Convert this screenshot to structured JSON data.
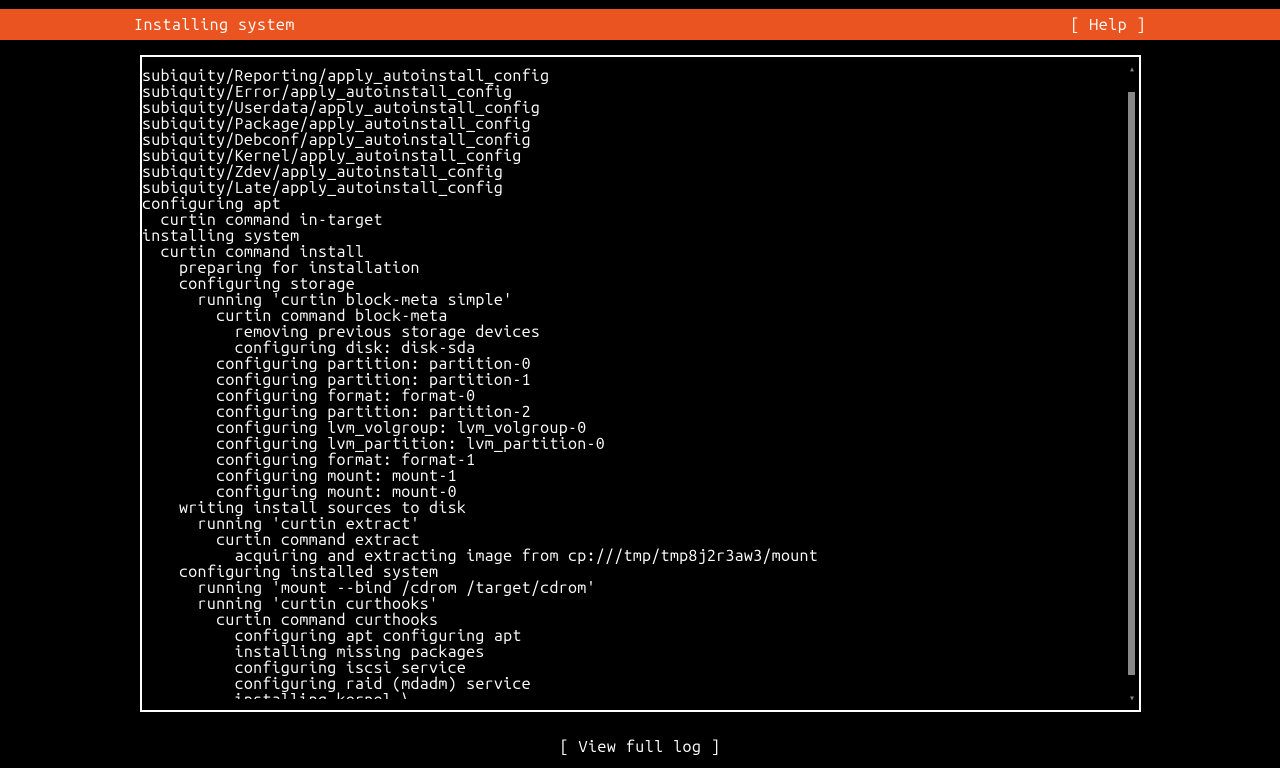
{
  "header": {
    "title": "Installing system",
    "help_label": "[ Help ]"
  },
  "footer": {
    "view_full_log": "[ View full log ]"
  },
  "log": {
    "lines": [
      {
        "indent": 0,
        "text": "subiquity/Reporting/apply_autoinstall_config"
      },
      {
        "indent": 0,
        "text": "subiquity/Error/apply_autoinstall_config"
      },
      {
        "indent": 0,
        "text": "subiquity/Userdata/apply_autoinstall_config"
      },
      {
        "indent": 0,
        "text": "subiquity/Package/apply_autoinstall_config"
      },
      {
        "indent": 0,
        "text": "subiquity/Debconf/apply_autoinstall_config"
      },
      {
        "indent": 0,
        "text": "subiquity/Kernel/apply_autoinstall_config"
      },
      {
        "indent": 0,
        "text": "subiquity/Zdev/apply_autoinstall_config"
      },
      {
        "indent": 0,
        "text": "subiquity/Late/apply_autoinstall_config"
      },
      {
        "indent": 0,
        "text": "configuring apt"
      },
      {
        "indent": 2,
        "text": "curtin command in-target"
      },
      {
        "indent": 0,
        "text": "installing system"
      },
      {
        "indent": 2,
        "text": "curtin command install"
      },
      {
        "indent": 4,
        "text": "preparing for installation"
      },
      {
        "indent": 4,
        "text": "configuring storage"
      },
      {
        "indent": 6,
        "text": "running 'curtin block-meta simple'"
      },
      {
        "indent": 8,
        "text": "curtin command block-meta"
      },
      {
        "indent": 10,
        "text": "removing previous storage devices"
      },
      {
        "indent": 10,
        "text": "configuring disk: disk-sda"
      },
      {
        "indent": 8,
        "text": "configuring partition: partition-0"
      },
      {
        "indent": 8,
        "text": "configuring partition: partition-1"
      },
      {
        "indent": 8,
        "text": "configuring format: format-0"
      },
      {
        "indent": 8,
        "text": "configuring partition: partition-2"
      },
      {
        "indent": 8,
        "text": "configuring lvm_volgroup: lvm_volgroup-0"
      },
      {
        "indent": 8,
        "text": "configuring lvm_partition: lvm_partition-0"
      },
      {
        "indent": 8,
        "text": "configuring format: format-1"
      },
      {
        "indent": 8,
        "text": "configuring mount: mount-1"
      },
      {
        "indent": 8,
        "text": "configuring mount: mount-0"
      },
      {
        "indent": 4,
        "text": "writing install sources to disk"
      },
      {
        "indent": 6,
        "text": "running 'curtin extract'"
      },
      {
        "indent": 8,
        "text": "curtin command extract"
      },
      {
        "indent": 10,
        "text": "acquiring and extracting image from cp:///tmp/tmp8j2r3aw3/mount"
      },
      {
        "indent": 4,
        "text": "configuring installed system"
      },
      {
        "indent": 6,
        "text": "running 'mount --bind /cdrom /target/cdrom'"
      },
      {
        "indent": 6,
        "text": "running 'curtin curthooks'"
      },
      {
        "indent": 8,
        "text": "curtin command curthooks"
      },
      {
        "indent": 10,
        "text": "configuring apt configuring apt"
      },
      {
        "indent": 10,
        "text": "installing missing packages"
      },
      {
        "indent": 10,
        "text": "configuring iscsi service"
      },
      {
        "indent": 10,
        "text": "configuring raid (mdadm) service"
      },
      {
        "indent": 10,
        "text": "installing kernel \\"
      }
    ]
  }
}
